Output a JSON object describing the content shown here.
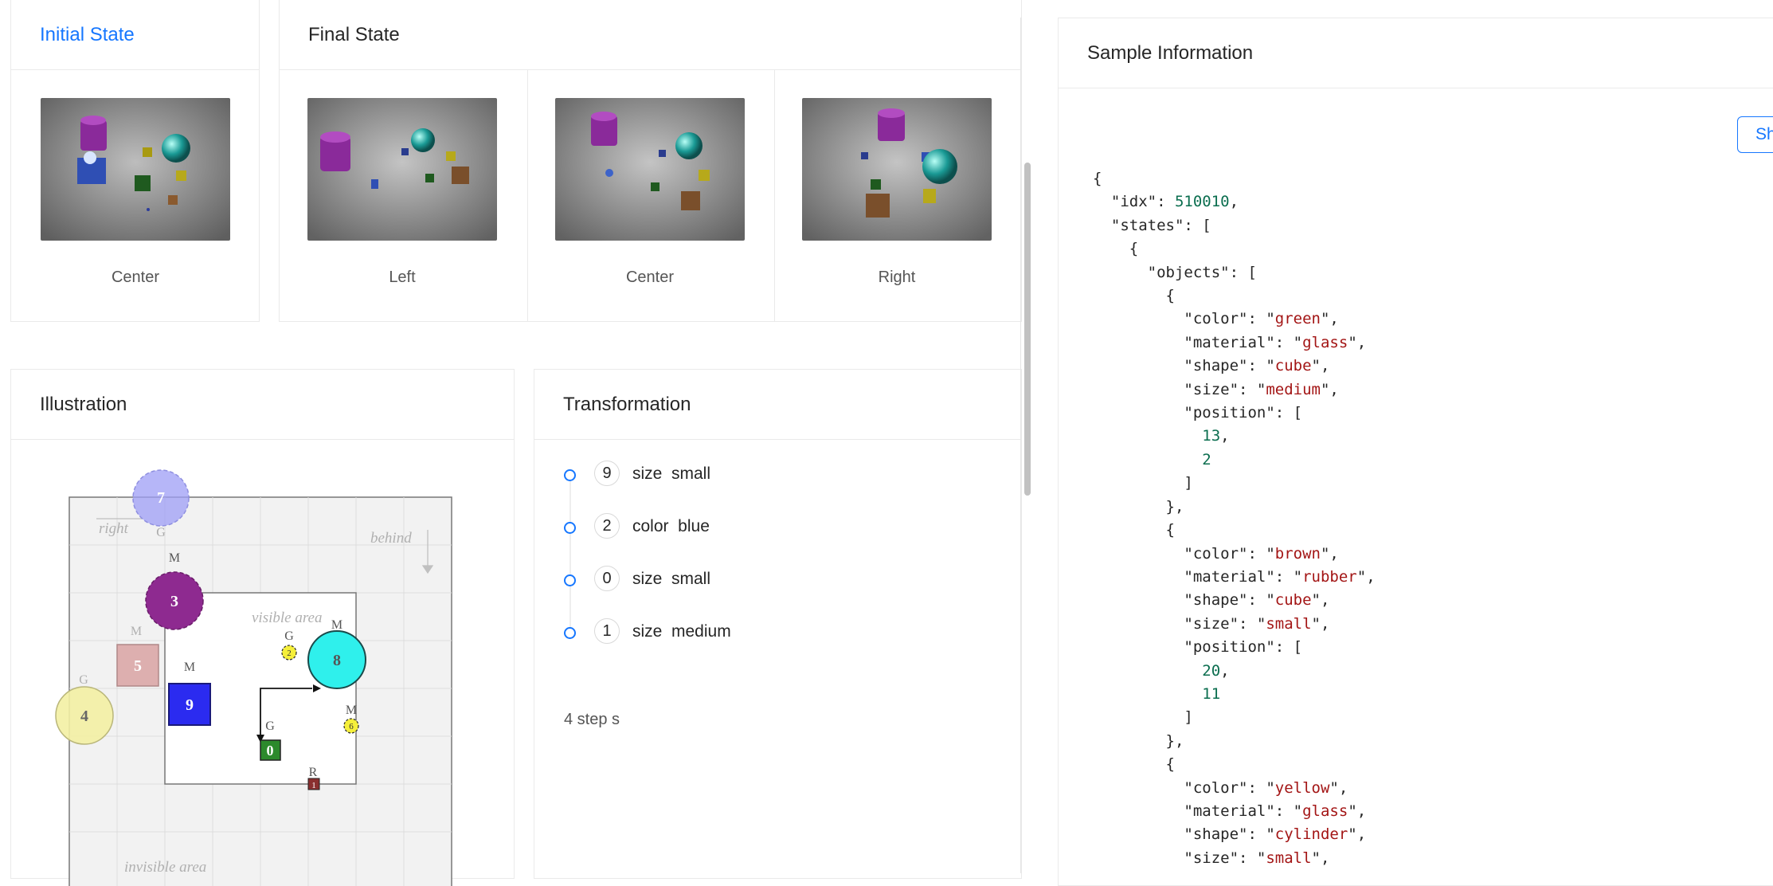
{
  "initial_state": {
    "title": "Initial State",
    "images": [
      {
        "caption": "Center"
      }
    ]
  },
  "final_state": {
    "title": "Final State",
    "images": [
      {
        "caption": "Left"
      },
      {
        "caption": "Center"
      },
      {
        "caption": "Right"
      }
    ]
  },
  "illustration": {
    "title": "Illustration",
    "labels": {
      "right": "right",
      "behind": "behind",
      "visible_area": "visible area",
      "invisible_area": "invisible area"
    },
    "objects": [
      {
        "id": "7",
        "material": "G"
      },
      {
        "id": "3",
        "material": "M"
      },
      {
        "id": "5",
        "material": "M"
      },
      {
        "id": "4",
        "material": "G"
      },
      {
        "id": "9",
        "material": "M"
      },
      {
        "id": "2",
        "material": "G"
      },
      {
        "id": "8",
        "material": "M"
      },
      {
        "id": "0",
        "material": "G"
      },
      {
        "id": "6",
        "material": "M"
      },
      {
        "id": "1",
        "material": "R"
      }
    ]
  },
  "transformation": {
    "title": "Transformation",
    "steps": [
      {
        "obj": "9",
        "text": "size  small"
      },
      {
        "obj": "2",
        "text": "color  blue"
      },
      {
        "obj": "0",
        "text": "size  small"
      },
      {
        "obj": "1",
        "text": "size  medium"
      }
    ],
    "summary": "4 step s"
  },
  "sample_info": {
    "title": "Sample Information",
    "show_button": "Sh"
  },
  "json_view": {
    "idx": 510010,
    "objects": [
      {
        "color": "green",
        "material": "glass",
        "shape": "cube",
        "size": "medium",
        "position": [
          13,
          2
        ]
      },
      {
        "color": "brown",
        "material": "rubber",
        "shape": "cube",
        "size": "small",
        "position": [
          20,
          11
        ]
      },
      {
        "color": "yellow",
        "material": "glass",
        "shape": "cylinder",
        "size": "small"
      }
    ]
  },
  "colors": {
    "accent": "#1677ff",
    "json_number": "#0b6e4f",
    "json_string": "#a31515"
  }
}
